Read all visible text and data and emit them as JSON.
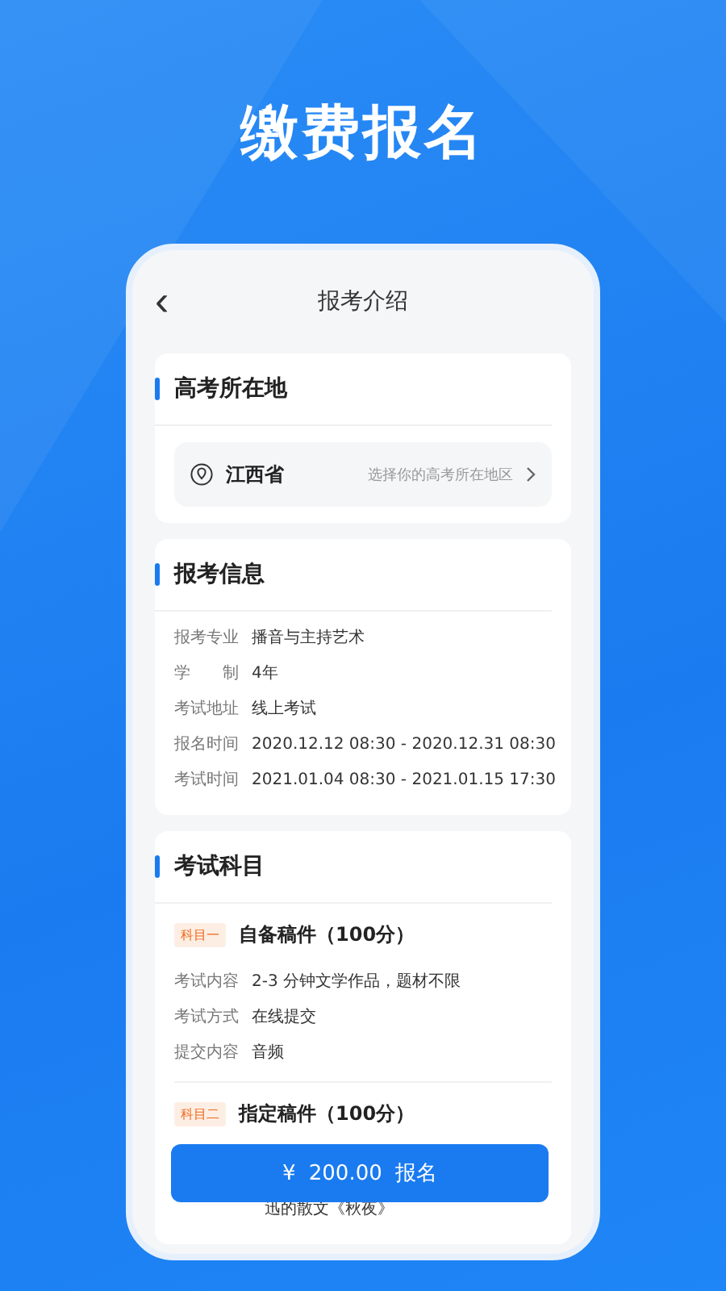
{
  "headline": "缴费报名",
  "nav": {
    "back": "‹",
    "title": "报考介绍"
  },
  "location": {
    "title": "高考所在地",
    "province": "江西省",
    "hint": "选择你的高考所在地区"
  },
  "info": {
    "title": "报考信息",
    "rows": [
      {
        "label": "报考专业",
        "value": "播音与主持艺术"
      },
      {
        "label": "学　　制",
        "value": "4年"
      },
      {
        "label": "考试地址",
        "value": "线上考试"
      },
      {
        "label": "报名时间",
        "value": "2020.12.12 08:30 - 2020.12.31 08:30"
      },
      {
        "label": "考试时间",
        "value": "2021.01.04 08:30 - 2021.01.15 17:30"
      }
    ]
  },
  "subjects": {
    "title": "考试科目",
    "items": [
      {
        "tag": "科目一",
        "name": "自备稿件（100分）",
        "rows": [
          {
            "label": "考试内容",
            "value": "2-3 分钟文学作品，题材不限"
          },
          {
            "label": "考试方式",
            "value": "在线提交"
          },
          {
            "label": "提交内容",
            "value": "音频"
          }
        ]
      },
      {
        "tag": "科目二",
        "name": "指定稿件（100分）",
        "rows": [
          {
            "value": "迅的散文《秋夜》"
          }
        ]
      }
    ]
  },
  "pay_button": {
    "price": "¥ 200.00",
    "label": "报名"
  }
}
